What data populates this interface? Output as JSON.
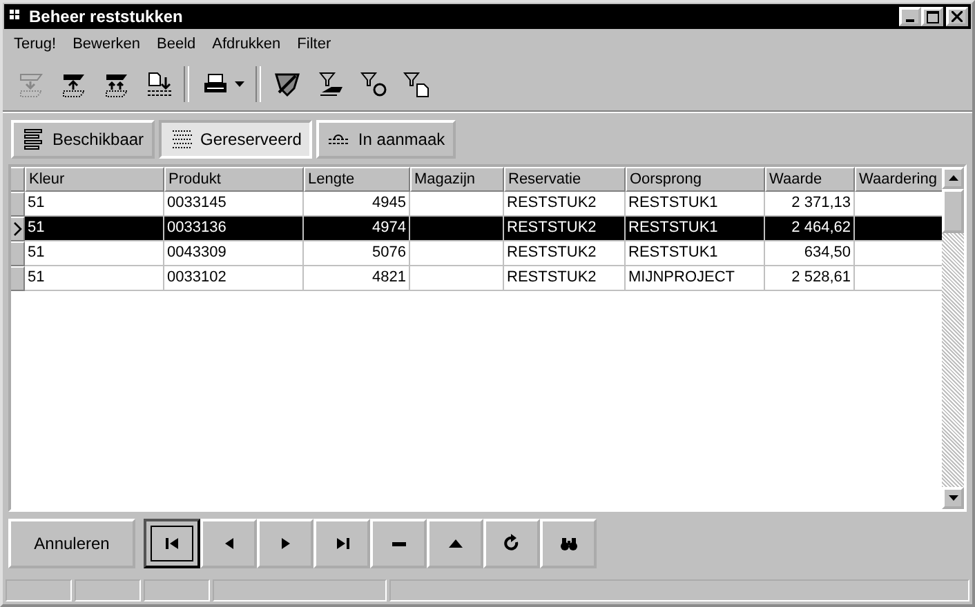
{
  "window": {
    "title": "Beheer reststukken"
  },
  "menu": [
    "Terug!",
    "Bewerken",
    "Beeld",
    "Afdrukken",
    "Filter"
  ],
  "toolbar": [
    [
      {
        "kind": "tray-down",
        "disabled": true
      },
      {
        "kind": "tray-up",
        "disabled": false
      },
      {
        "kind": "tray-double-up",
        "disabled": false
      },
      {
        "kind": "doc-transfer",
        "disabled": false
      }
    ],
    [
      {
        "kind": "printer",
        "disabled": false
      }
    ],
    [
      {
        "kind": "filter-off",
        "disabled": false
      },
      {
        "kind": "filter-hand",
        "disabled": false
      },
      {
        "kind": "filter-money",
        "disabled": false
      },
      {
        "kind": "filter-doc",
        "disabled": false
      }
    ]
  ],
  "views": [
    {
      "label": "Beschikbaar",
      "kind": "lines",
      "selected": false
    },
    {
      "label": "Gereserveerd",
      "kind": "hatch",
      "selected": true
    },
    {
      "label": "In aanmaak",
      "kind": "bar",
      "selected": false
    }
  ],
  "table": {
    "columns": [
      {
        "label": "Kleur",
        "kind": "text"
      },
      {
        "label": "Produkt",
        "kind": "text"
      },
      {
        "label": "Lengte",
        "kind": "number"
      },
      {
        "label": "Magazijn",
        "kind": "text"
      },
      {
        "label": "Reservatie",
        "kind": "text"
      },
      {
        "label": "Oorsprong",
        "kind": "text"
      },
      {
        "label": "Waarde",
        "kind": "number"
      },
      {
        "label": "Waardering",
        "kind": "text"
      }
    ],
    "rows": [
      {
        "selected": false,
        "cells": [
          "51",
          "0033145",
          "4945",
          "",
          "RESTSTUK2",
          "RESTSTUK1",
          "2 371,13",
          ""
        ]
      },
      {
        "selected": true,
        "cells": [
          "51",
          "0033136",
          "4974",
          "",
          "RESTSTUK2",
          "RESTSTUK1",
          "2 464,62",
          ""
        ]
      },
      {
        "selected": false,
        "cells": [
          "51",
          "0043309",
          "5076",
          "",
          "RESTSTUK2",
          "RESTSTUK1",
          "634,50",
          ""
        ]
      },
      {
        "selected": false,
        "cells": [
          "51",
          "0033102",
          "4821",
          "",
          "RESTSTUK2",
          "MIJNPROJECT",
          "2 528,61",
          ""
        ]
      }
    ]
  },
  "cancel_button": "Annuleren",
  "navigator": [
    {
      "kind": "first",
      "focused": true
    },
    {
      "kind": "prior",
      "focused": false
    },
    {
      "kind": "next",
      "focused": false
    },
    {
      "kind": "last",
      "focused": false
    },
    {
      "kind": "delete",
      "focused": false
    },
    {
      "kind": "post",
      "focused": false
    },
    {
      "kind": "refresh",
      "focused": false
    },
    {
      "kind": "search",
      "focused": false
    }
  ]
}
